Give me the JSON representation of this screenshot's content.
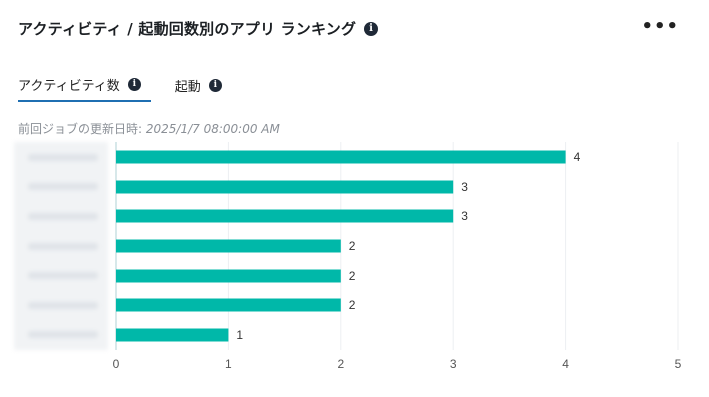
{
  "card": {
    "title": "アクティビティ / 起動回数別のアプリ ランキング",
    "info_glyph": "i",
    "more_label": "•••"
  },
  "tabs": [
    {
      "label": "アクティビティ数",
      "active": true
    },
    {
      "label": "起動",
      "active": false
    }
  ],
  "updated": {
    "label": "前回ジョブの更新日時: ",
    "timestamp": "2025/1/7 08:00:00 AM"
  },
  "chart_data": {
    "type": "bar",
    "orientation": "horizontal",
    "categories": [
      "",
      "",
      "",
      "",
      "",
      "",
      ""
    ],
    "values": [
      4,
      3,
      3,
      2,
      2,
      2,
      1
    ],
    "xlim": [
      0,
      5
    ],
    "xticks": [
      0,
      1,
      2,
      3,
      4,
      5
    ],
    "grid": true,
    "bar_color": "#00b8a9",
    "category_labels_blurred": true
  }
}
